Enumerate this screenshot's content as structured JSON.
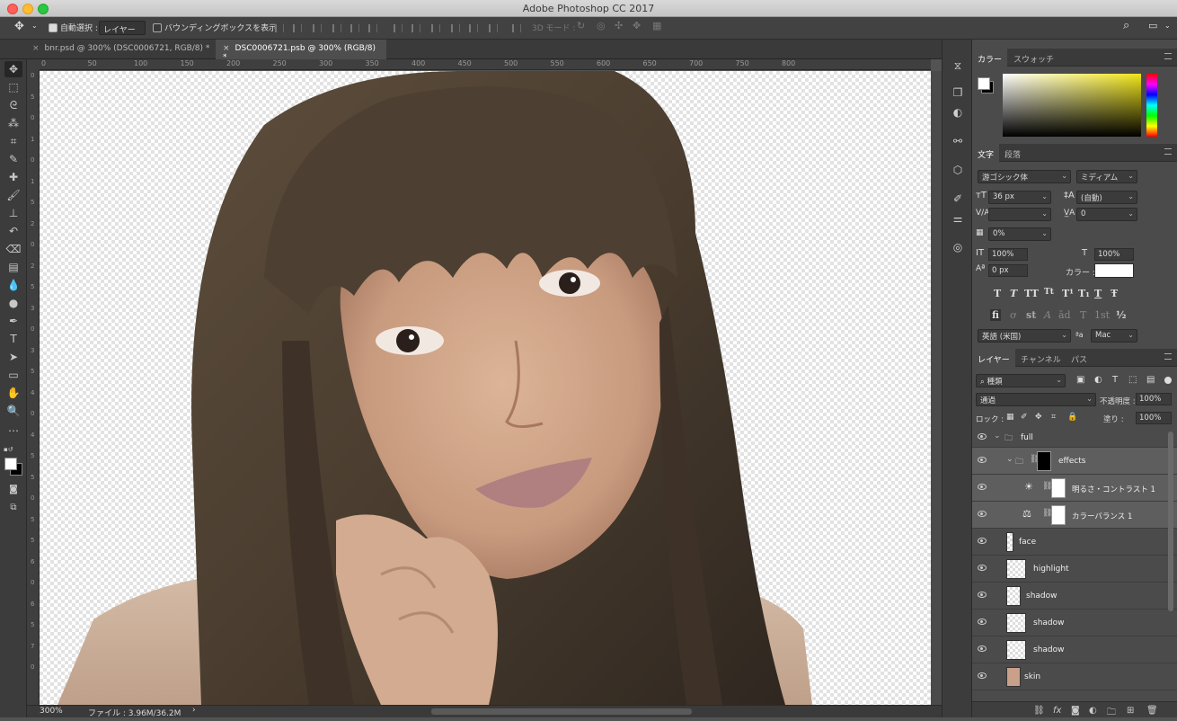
{
  "window": {
    "title": "Adobe Photoshop CC 2017"
  },
  "options_bar": {
    "auto_select_label": "自動選択 :",
    "auto_select_target": "レイヤー",
    "show_bounding_box": "バウンディングボックスを表示",
    "mode_3d": "3D モード :"
  },
  "documents": [
    {
      "label": "bnr.psd @ 300% (DSC0006721, RGB/8) *"
    },
    {
      "label": "DSC0006721.psb @ 300% (RGB/8) *"
    }
  ],
  "rulers": {
    "top": [
      "0",
      "50",
      "100",
      "150",
      "200",
      "250",
      "300",
      "350",
      "400",
      "450",
      "500",
      "550",
      "600",
      "650",
      "700",
      "750",
      "800"
    ],
    "left": [
      "0",
      "5",
      "0",
      "1",
      "0",
      "1",
      "5",
      "2",
      "0",
      "2",
      "5",
      "3",
      "0",
      "3",
      "5",
      "4",
      "0",
      "4",
      "5",
      "5",
      "0",
      "5",
      "5",
      "6",
      "0",
      "6",
      "5",
      "7",
      "0"
    ]
  },
  "status": {
    "zoom": "300%",
    "file_info": "ファイル : 3.96M/36.2M"
  },
  "color_panel": {
    "tabs": [
      "カラー",
      "スウォッチ"
    ]
  },
  "character_panel": {
    "tabs": [
      "文字",
      "段落"
    ],
    "font_family": "游ゴシック体",
    "font_style": "ミディアム",
    "font_size": "36 px",
    "leading": "(自動)",
    "kerning": "",
    "tracking": "0",
    "tsume": "0%",
    "vertical_scale": "100%",
    "horizontal_scale": "100%",
    "baseline_shift": "0 px",
    "color_label": "カラー :",
    "style_buttons": [
      "T",
      "T",
      "TT",
      "Tt",
      "T¹",
      "T₁",
      "T",
      "Ŧ"
    ],
    "opentype_buttons": [
      "fi",
      "ơ",
      "st",
      "A",
      "ād",
      "T",
      "1st",
      "½"
    ],
    "language": "英語 (米国)",
    "aa_label": "ªa",
    "antialias": "Mac"
  },
  "layers_panel": {
    "tabs": [
      "レイヤー",
      "チャンネル",
      "パス"
    ],
    "filter_kind": "種類",
    "blend_mode": "通過",
    "opacity_label": "不透明度 :",
    "opacity": "100%",
    "lock_label": "ロック :",
    "fill_label": "塗り :",
    "fill": "100%",
    "layers": [
      {
        "name": "full"
      },
      {
        "name": "effects"
      },
      {
        "name": "明るさ・コントラスト 1"
      },
      {
        "name": "カラーバランス 1"
      },
      {
        "name": "face"
      },
      {
        "name": "highlight"
      },
      {
        "name": "shadow"
      },
      {
        "name": "shadow"
      },
      {
        "name": "shadow"
      },
      {
        "name": "skin"
      }
    ]
  },
  "colors": {
    "accent": "#4b4b4b",
    "foreground": "#ffffff",
    "background": "#000000"
  }
}
